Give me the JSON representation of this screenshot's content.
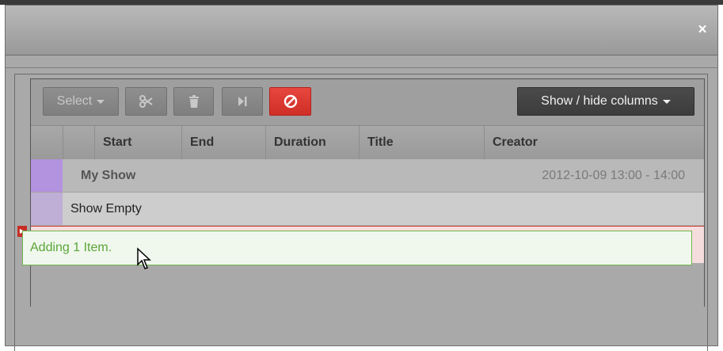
{
  "dialog": {
    "close_label": "×"
  },
  "toolbar": {
    "select_label": "Select",
    "cut_icon": "scissors-icon",
    "delete_icon": "trash-icon",
    "skip_icon": "skip-to-end-icon",
    "cancel_icon": "prohibited-icon",
    "columns_label": "Show / hide columns"
  },
  "table": {
    "headers": [
      "Start",
      "End",
      "Duration",
      "Title",
      "Creator"
    ],
    "show_row": {
      "name": "My Show",
      "time": "2012-10-09 13:00 - 14:00",
      "color": "#b392e0"
    },
    "empty_row": {
      "label": "Show Empty",
      "color": "#bfaed6"
    }
  },
  "drag": {
    "message": "Adding 1 Item."
  },
  "colors": {
    "accent_red": "#d9342c",
    "success_green": "#6fb54e"
  }
}
